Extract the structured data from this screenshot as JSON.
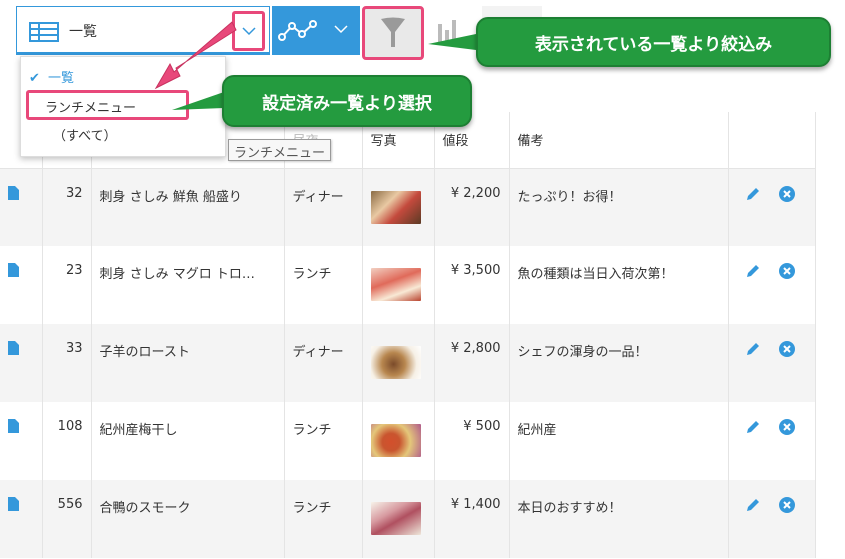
{
  "toolbar": {
    "view_label": "一覧"
  },
  "dropdown": {
    "items": [
      {
        "label": "一覧",
        "checked": true
      },
      {
        "label": "ランチメニュー",
        "checked": false
      },
      {
        "label": "（すべて）",
        "checked": false
      }
    ],
    "tooltip": "ランチメニュー"
  },
  "callouts": {
    "filter": "表示されている一覧より絞込み",
    "select": "設定済み一覧より選択"
  },
  "table": {
    "headers": {
      "time": "昼夜",
      "photo": "写真",
      "price": "値段",
      "note": "備考"
    },
    "rows": [
      {
        "id": "32",
        "name": "刺身 さしみ 鮮魚 船盛り",
        "time": "ディナー",
        "price": "¥ 2,200",
        "note": "たっぷり！お得！"
      },
      {
        "id": "23",
        "name": "刺身 さしみ マグロ トロ…",
        "time": "ランチ",
        "price": "¥ 3,500",
        "note": "魚の種類は当日入荷次第！"
      },
      {
        "id": "33",
        "name": "子羊のロースト",
        "time": "ディナー",
        "price": "¥ 2,800",
        "note": "シェフの渾身の一品！"
      },
      {
        "id": "108",
        "name": "紀州産梅干し",
        "time": "ランチ",
        "price": "¥ 500",
        "note": "紀州産"
      },
      {
        "id": "556",
        "name": "合鴨のスモーク",
        "time": "ランチ",
        "price": "¥ 1,400",
        "note": "本日のおすすめ！"
      }
    ]
  },
  "colors": {
    "accent": "#3498db",
    "highlight": "#e8487a",
    "callout": "#249b3f"
  }
}
